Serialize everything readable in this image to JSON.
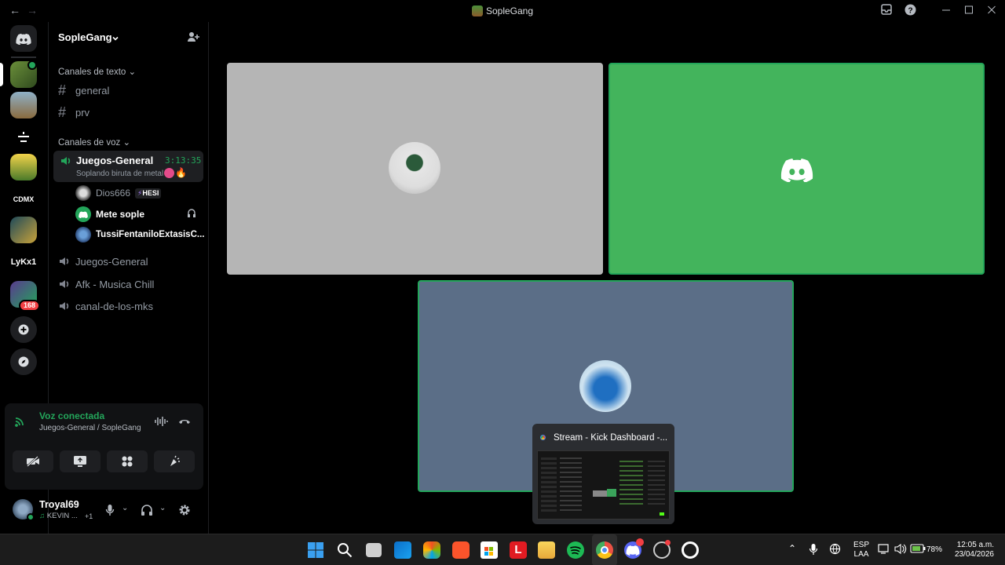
{
  "window": {
    "title": "SopleGang",
    "back_glyph": "←",
    "forward_glyph": "→"
  },
  "rail": {
    "badge_count": "168",
    "text_servers": [
      "CDMX",
      "LyKx1"
    ]
  },
  "sidebar": {
    "guild_name": "SopleGang",
    "text_category": "Canales de texto",
    "text_channels": [
      "general",
      "prv"
    ],
    "voice_category": "Canales de voz",
    "active_voice": {
      "name": "Juegos-General",
      "timer": "3:13:35",
      "status": "Soplando biruta de metal"
    },
    "voice_users": [
      {
        "name": "Dios666",
        "tag": "HESI"
      },
      {
        "name": "Mete sople"
      },
      {
        "name": "TussiFentaniloExtasisC..."
      }
    ],
    "voice_channels": [
      "Juegos-General",
      "Afk - Musica Chill",
      "canal-de-los-mks"
    ]
  },
  "voice_panel": {
    "status": "Voz conectada",
    "location": "Juegos-General / SopleGang"
  },
  "user_panel": {
    "username": "Troyal69",
    "activity": "KEVIN ...",
    "extra": "+1"
  },
  "stream_preview": {
    "title": "Stream - Kick Dashboard -..."
  },
  "taskbar": {
    "lang1": "ESP",
    "lang2": "LAA",
    "battery": "78%",
    "time": "12:05 a.m.",
    "date": "23/04/2026"
  },
  "colors": {
    "accent_green": "#23a55a",
    "tile_gray": "#b5b5b5",
    "tile_green": "#43b45c",
    "tile_slate": "#5b6e87",
    "badge_red": "#f23f43"
  }
}
